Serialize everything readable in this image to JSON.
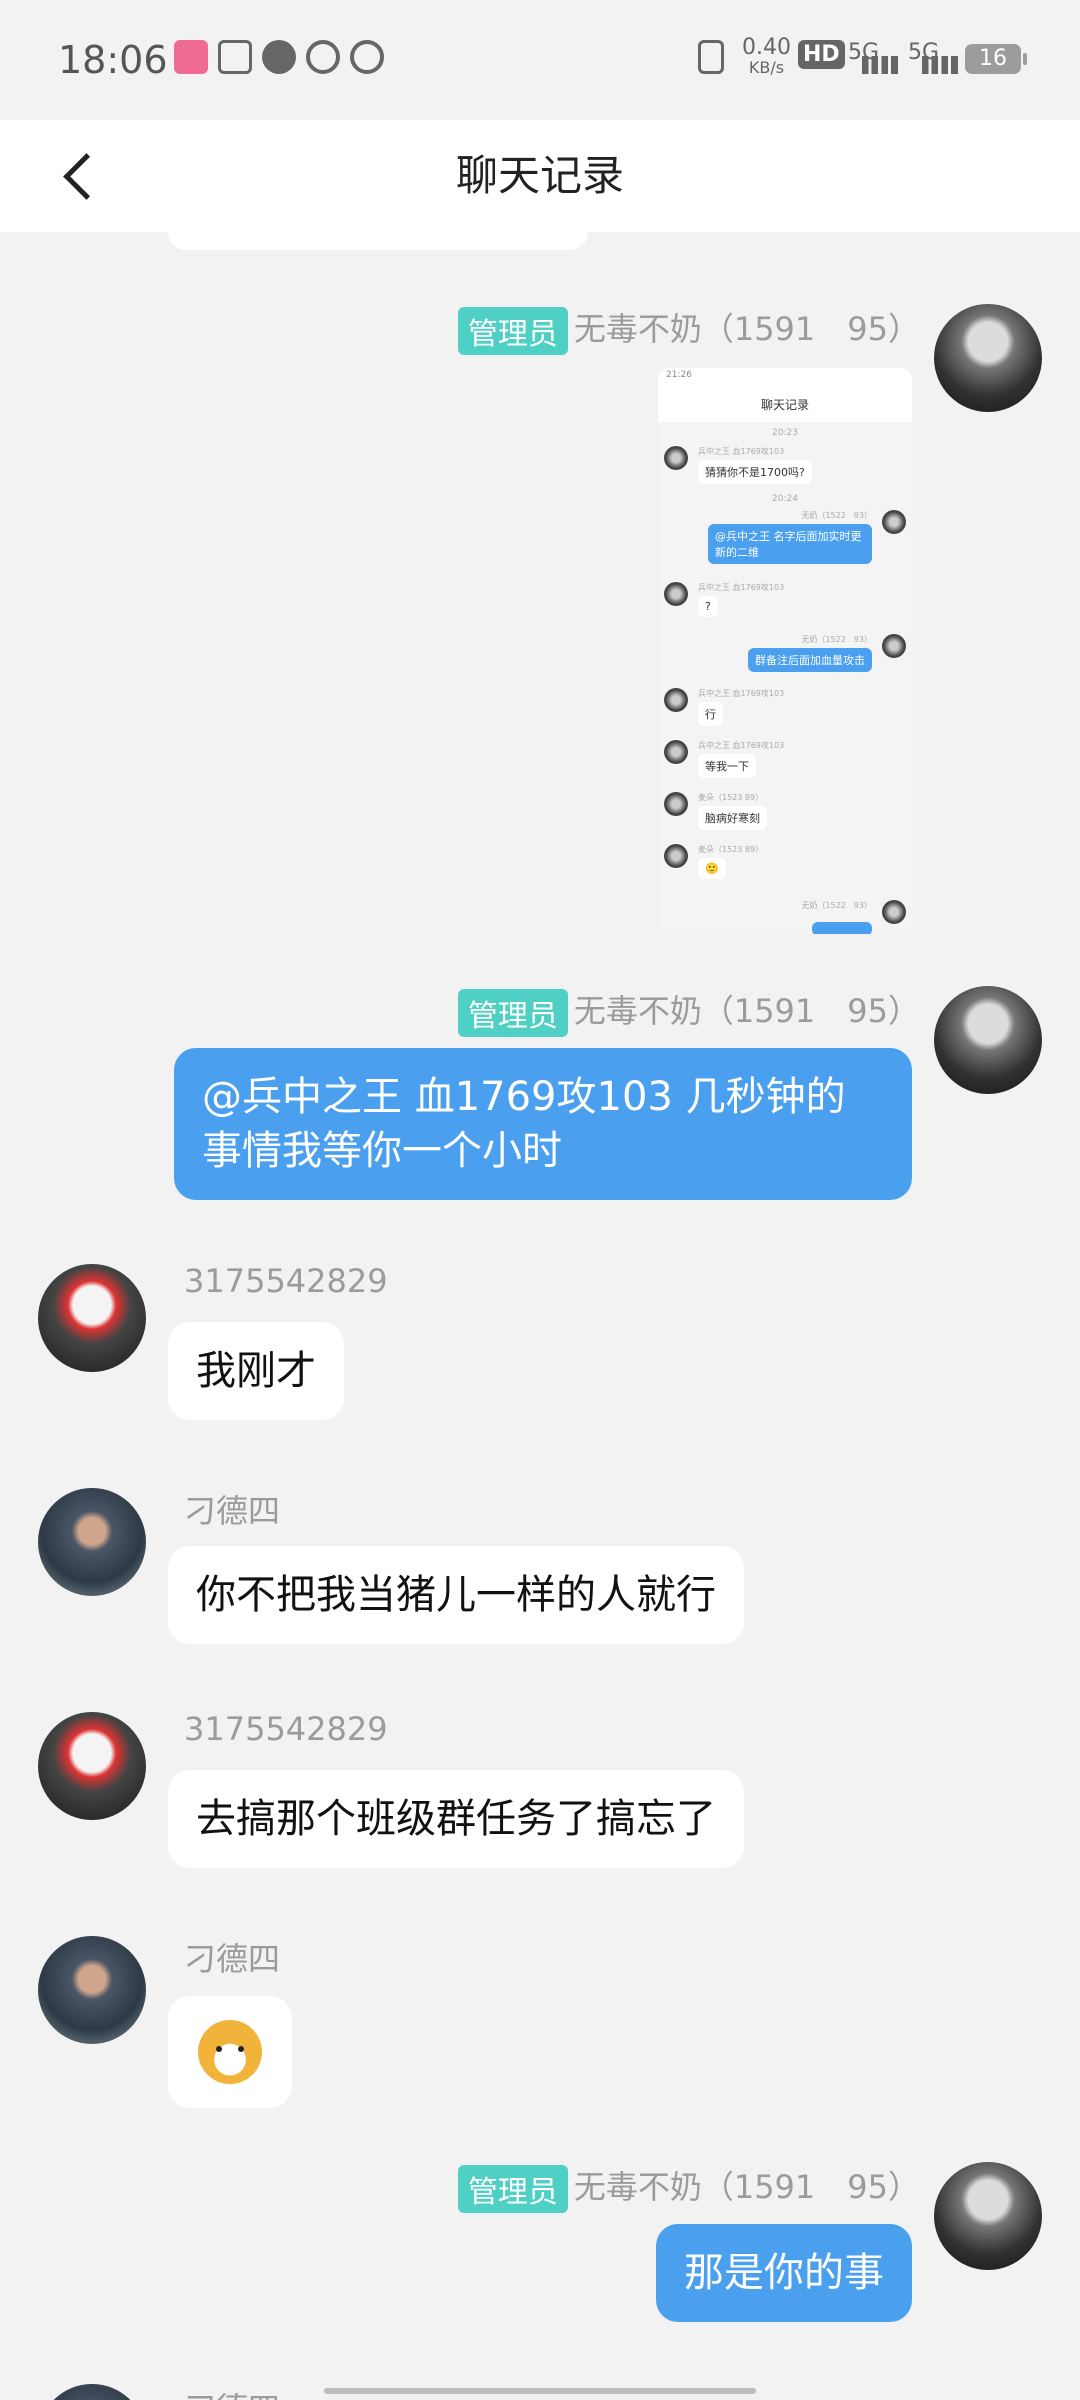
{
  "status": {
    "time": "18:06",
    "net_speed": "0.40\nKB/s",
    "net_speed_top": "0.40",
    "net_speed_bottom": "KB/s",
    "signal1": "5G",
    "signal2": "5G",
    "hd": "HD",
    "battery": "16",
    "icons_left": [
      "app-icon",
      "alipay-icon",
      "message-icon",
      "netease-icon",
      "weibo-icon"
    ],
    "icons_right": [
      "vibrate-icon",
      "hd-icon",
      "signal-icon",
      "signal-icon",
      "battery-icon"
    ]
  },
  "header": {
    "title": "聊天记录",
    "back_icon": "back-arrow-icon"
  },
  "badges": {
    "admin": "管理员"
  },
  "messages": [
    {
      "side": "right",
      "sender": "无毒不奶（1591　95）",
      "type": "image"
    },
    {
      "side": "right",
      "sender": "无毒不奶（1591　95）",
      "text": "@兵中之王 血1769攻103 几秒钟的事情我等你一个小时"
    },
    {
      "side": "left",
      "sender": "3175542829",
      "text": "我刚才"
    },
    {
      "side": "left",
      "sender": "刁德四",
      "text": "你不把我当猪儿一样的人就行"
    },
    {
      "side": "left",
      "sender": "3175542829",
      "text": "去搞那个班级群任务了搞忘了"
    },
    {
      "side": "left",
      "sender": "刁德四",
      "type": "sticker"
    },
    {
      "side": "right",
      "sender": "无毒不奶（1591　95）",
      "text": "那是你的事"
    },
    {
      "side": "left",
      "sender": "刁德四"
    }
  ],
  "embedded_shot": {
    "status_time": "21:26",
    "title": "聊天记录",
    "time1": "20:23",
    "time2": "20:24",
    "n1": "兵中之王 血1769攻103",
    "m1": "猜猜你不是1700吗?",
    "n2": "无奶（1522　93）",
    "m2": "@兵中之王 名字后面加实时更新的二维",
    "n3": "兵中之王 血1769攻103",
    "m3": "?",
    "n4": "无奶（1522　93）",
    "m4": "群备注后面加血量攻击",
    "n5": "兵中之王 血1769攻103",
    "m5": "行",
    "n6": "兵中之王 血1769攻103",
    "m6": "等我一下",
    "n7": "麦朵（1523 89）",
    "m7": "脑病好寒刻",
    "n8": "麦朵（1523 89）",
    "m8": "🙂",
    "n9": "无奶（1522　93）"
  }
}
